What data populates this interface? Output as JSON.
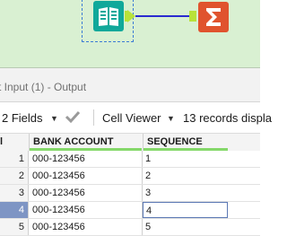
{
  "results_window": {
    "title": "t Input (1) - Output"
  },
  "toolbar": {
    "fields_label": "2 Fields",
    "viewer_label": "Cell Viewer",
    "records_label": "13 records displa"
  },
  "grid": {
    "header_record": "l",
    "columns": [
      "BANK ACCOUNT",
      "SEQUENCE"
    ],
    "rows": [
      {
        "num": "1",
        "bank": "000-123456",
        "seq": "1"
      },
      {
        "num": "2",
        "bank": "000-123456",
        "seq": "2"
      },
      {
        "num": "3",
        "bank": "000-123456",
        "seq": "3"
      },
      {
        "num": "4",
        "bank": "000-123456",
        "seq": "4"
      },
      {
        "num": "5",
        "bank": "000-123456",
        "seq": "5"
      }
    ],
    "selected_row": "4"
  },
  "icons": {
    "input_tool": "book-icon",
    "summarize_tool": "sigma-icon",
    "fields_caret": "chevron-down-icon",
    "apply_check": "check-icon",
    "viewer_caret": "chevron-down-icon"
  },
  "colors": {
    "canvas_bg": "#d9f0d2",
    "input_tool": "#10a89a",
    "summarize_tool": "#e0532e",
    "anchor": "#b8e23a",
    "connection": "#2a2ad0",
    "header_underline": "#85d86a",
    "selected_row": "#7e95c4"
  }
}
